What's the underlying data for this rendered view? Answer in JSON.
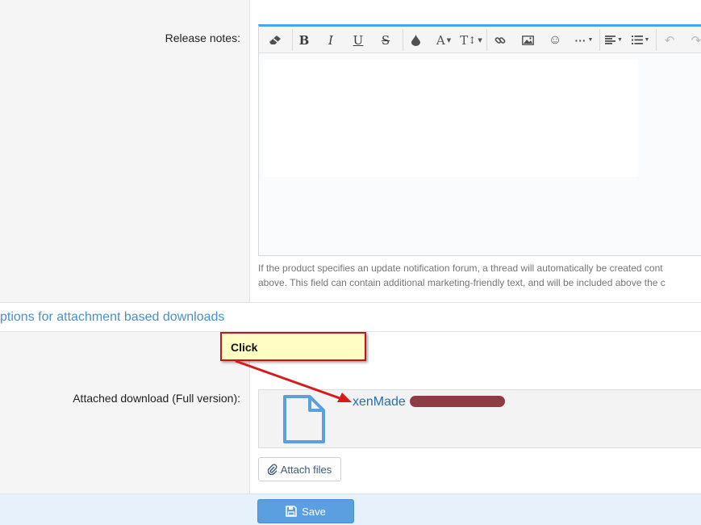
{
  "release_notes": {
    "label": "Release notes:",
    "hint_line1": "If the product specifies an update notification forum, a thread will automatically be created cont",
    "hint_line2": "above. This field can contain additional marketing-friendly text, and will be included above the c"
  },
  "toolbar": {
    "items": [
      {
        "name": "clear-formatting",
        "label": ""
      },
      {
        "name": "bold",
        "label": "B"
      },
      {
        "name": "italic",
        "label": "I"
      },
      {
        "name": "underline",
        "label": "U"
      },
      {
        "name": "strikethrough",
        "label": "S"
      },
      {
        "name": "text-color",
        "label": ""
      },
      {
        "name": "font-family",
        "label": "A"
      },
      {
        "name": "font-size",
        "label": "T"
      },
      {
        "name": "link",
        "label": ""
      },
      {
        "name": "image",
        "label": ""
      },
      {
        "name": "smilies",
        "label": "☺"
      },
      {
        "name": "more",
        "label": "···"
      },
      {
        "name": "align",
        "label": ""
      },
      {
        "name": "list",
        "label": ""
      },
      {
        "name": "undo",
        "label": "↶"
      },
      {
        "name": "redo",
        "label": "↷"
      }
    ]
  },
  "section": {
    "title": "ptions for attachment based downloads"
  },
  "attachment": {
    "label": "Attached download (Full version):",
    "file_name_visible": "xenMade",
    "attach_button": "Attach files"
  },
  "callout": {
    "text": "Click"
  },
  "footer": {
    "save_label": "Save"
  },
  "colors": {
    "accent": "#47a7eb",
    "link": "#2a6db0",
    "save_button": "#5a9fe0",
    "callout_border": "#c01818",
    "callout_fill": "#fffdc4"
  }
}
